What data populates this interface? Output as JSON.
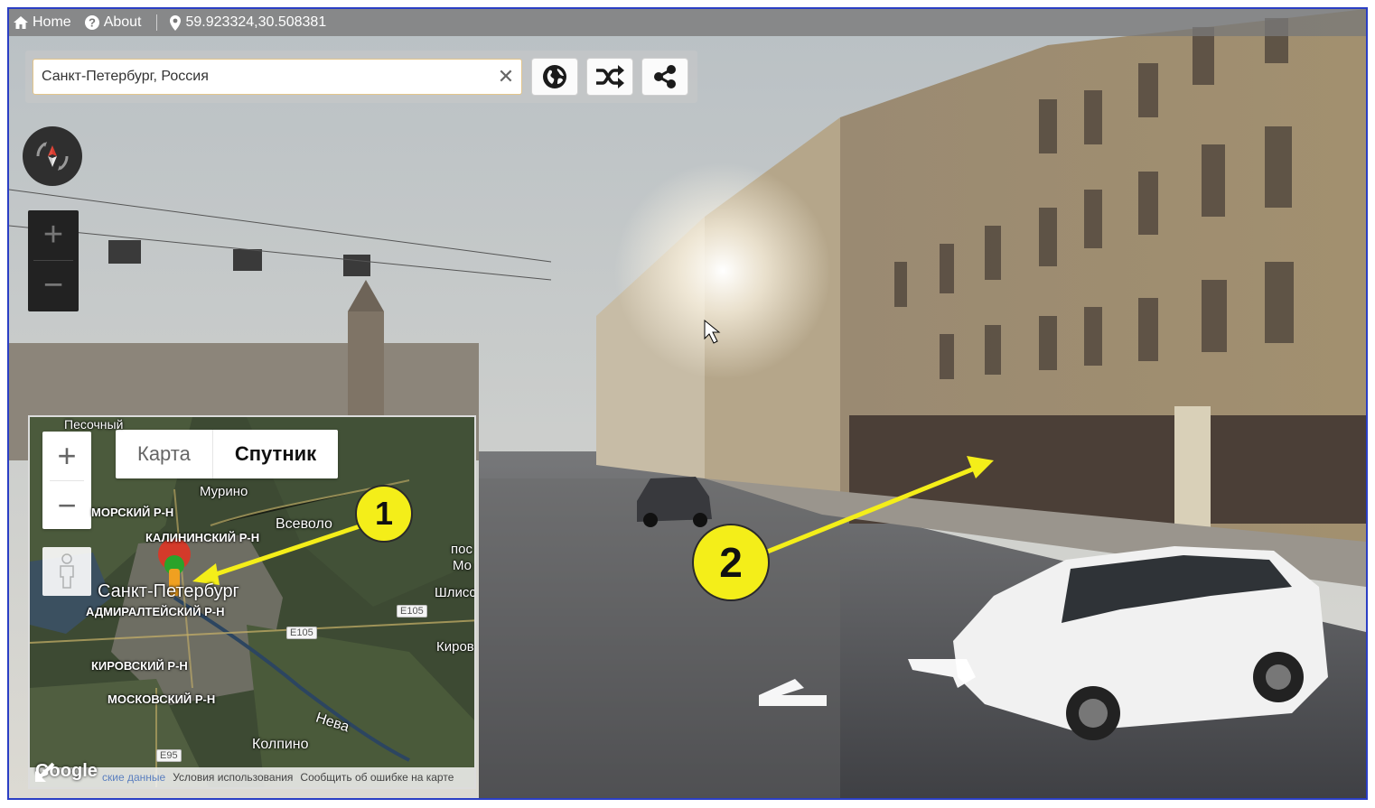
{
  "nav": {
    "home_label": "Home",
    "about_label": "About",
    "coordinates": "59.923324,30.508381",
    "icons": [
      "home-icon",
      "help-icon",
      "map-pin-icon"
    ]
  },
  "search": {
    "value": "Санкт-Петербург, Россия",
    "clear_icon": "close-icon",
    "buttons": [
      "globe-icon",
      "shuffle-icon",
      "share-icon"
    ]
  },
  "minimap": {
    "map_type_options": [
      "Карта",
      "Спутник"
    ],
    "selected_map_type": "Спутник",
    "labels": {
      "pesochny": "Песочный",
      "murino": "Мурино",
      "primorsky": "МОРСКИЙ Р-Н",
      "kalininsky": "КАЛИНИНСКИЙ Р-Н",
      "vsevolozhsk": "Всеволо",
      "spb": "Санкт-Петербург",
      "admiralteysky": "АДМИРАЛТЕЙСКИЙ Р-Н",
      "kirovsky": "КИРОВСКИЙ Р-Н",
      "moskovsky": "МОСКОВСКИЙ Р-Н",
      "neva": "Нева",
      "kolpino": "Колпино",
      "pos": "пос",
      "mo": "Мо",
      "shlis": "Шлисс",
      "kirov": "Киров",
      "e105a": "E105",
      "e105b": "E105",
      "e95": "E95"
    },
    "footer": {
      "google": "Google",
      "map_data": "ские данные",
      "terms": "Условия использования",
      "report": "Сообщить об ошибке на карте"
    }
  },
  "annotations": {
    "badge1": "1",
    "badge2": "2"
  },
  "colors": {
    "frame": "#2b3fc4",
    "badge": "#f4ee19",
    "search_border": "#e3c58a"
  }
}
